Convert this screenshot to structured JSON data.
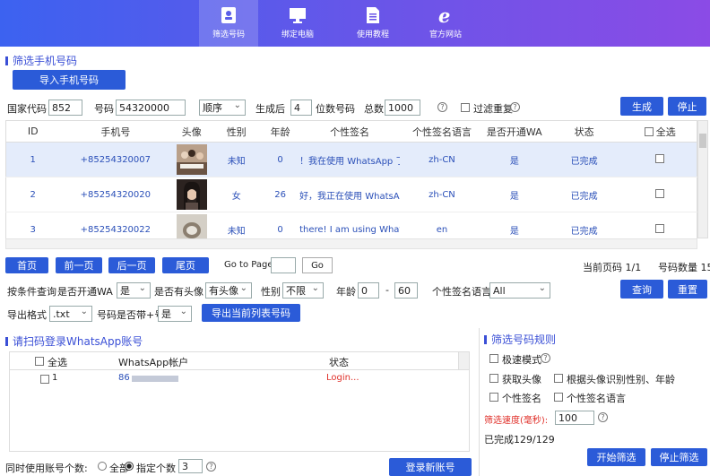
{
  "nav": [
    {
      "label": "筛选号码",
      "icon": "id-card-icon"
    },
    {
      "label": "绑定电脑",
      "icon": "monitor-icon"
    },
    {
      "label": "使用教程",
      "icon": "document-icon"
    },
    {
      "label": "官方网站",
      "icon": "browser-e-icon"
    }
  ],
  "filter_section": {
    "title": "筛选手机号码",
    "import_label": "导入手机号码",
    "country_code_label": "国家代码",
    "country_code": "852",
    "number_label": "号码",
    "number_value": "54320000",
    "order_value": "顺序",
    "generate_after_label": "生成后",
    "generate_after_value": "4",
    "digits_label": "位数号码",
    "total_label": "总数",
    "total_value": "1000",
    "filter_dup_label": "过滤重复",
    "generate_label": "生成",
    "stop_label": "停止"
  },
  "table": {
    "headers": [
      "ID",
      "手机号",
      "头像",
      "性别",
      "年龄",
      "个性签名",
      "个性签名语言",
      "是否开通WA",
      "状态",
      "全选"
    ],
    "rows": [
      {
        "id": "1",
        "phone": "+85254320007",
        "gender": "未知",
        "age": "0",
        "signature": "！我在使用 WhatsApp 了",
        "lang": "zh-CN",
        "wa": "是",
        "status": "已完成"
      },
      {
        "id": "2",
        "phone": "+85254320020",
        "gender": "女",
        "age": "26",
        "signature": "好，我正在使用 WhatsAp",
        "lang": "zh-CN",
        "wa": "是",
        "status": "已完成"
      },
      {
        "id": "3",
        "phone": "+85254320022",
        "gender": "未知",
        "age": "0",
        "signature": "there! I am using Whats",
        "lang": "en",
        "wa": "是",
        "status": "已完成"
      }
    ]
  },
  "pager": {
    "first": "首页",
    "prev": "前一页",
    "next": "后一页",
    "last": "尾页",
    "goto_label": "Go to Page",
    "go": "Go",
    "current_page": "当前页码 1/1",
    "count": "号码数量 15"
  },
  "query": {
    "by_condition": "按条件查询",
    "wa_label": "是否开通WA",
    "wa_value": "是",
    "avatar_label": "是否有头像",
    "avatar_value": "有头像",
    "gender_label": "性别",
    "gender_value": "不限",
    "age_label": "年龄",
    "age_min": "0",
    "age_dash": "-",
    "age_max": "60",
    "lang_label": "个性签名语言",
    "lang_value": "All",
    "query_btn": "查询",
    "reset_btn": "重置"
  },
  "export": {
    "format_label": "导出格式",
    "format_value": ".txt",
    "plus_label": "号码是否带+号:",
    "plus_value": "是",
    "export_btn": "导出当前列表号码"
  },
  "login": {
    "title": "请扫码登录WhatsApp账号",
    "select_all": "全选",
    "col_account": "WhatsApp帐户",
    "col_status": "状态",
    "row_id": "1",
    "row_account": "86",
    "row_status": "Login...",
    "accounts_label": "同时使用账号个数:",
    "all_label": "全部",
    "specified_label": "指定个数",
    "specified_value": "3",
    "login_btn": "登录新账号"
  },
  "rules": {
    "title": "筛选号码规则",
    "fast_mode": "极速模式",
    "get_avatar": "获取头像",
    "avatar_recog": "根据头像识别性别、年龄",
    "signature": "个性签名",
    "signature_lang": "个性签名语言",
    "speed_label": "筛选速度(毫秒):",
    "speed_value": "100",
    "done": "已完成129/129",
    "start_btn": "开始筛选",
    "stop_btn": "停止筛选"
  },
  "colors": {
    "accent": "#2b5bd8",
    "status_red": "#e0302a",
    "header_start": "#3c62f0",
    "header_end": "#8b4be6"
  }
}
